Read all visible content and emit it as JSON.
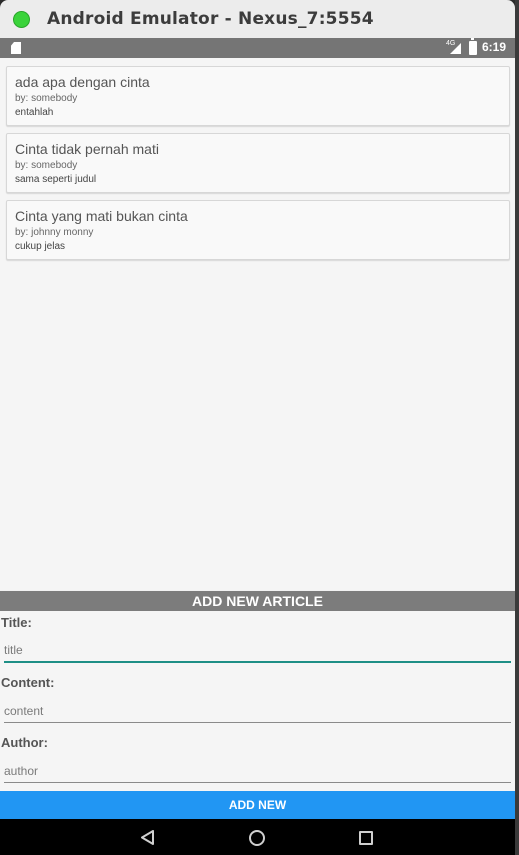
{
  "window": {
    "title": "Android Emulator - Nexus_7:5554"
  },
  "statusbar": {
    "network": "4G",
    "time": "6:19"
  },
  "articles": [
    {
      "title": "ada apa dengan cinta",
      "author": "by: somebody",
      "content": "entahlah"
    },
    {
      "title": "Cinta tidak pernah mati",
      "author": "by: somebody",
      "content": "sama seperti judul"
    },
    {
      "title": "Cinta yang mati bukan cinta",
      "author": "by: johnny monny",
      "content": "cukup jelas"
    }
  ],
  "form": {
    "header": "ADD NEW ARTICLE",
    "title_label": "Title:",
    "title_placeholder": "title",
    "content_label": "Content:",
    "content_placeholder": "content",
    "author_label": "Author:",
    "author_placeholder": "author",
    "submit_label": "ADD NEW"
  },
  "colors": {
    "accent": "#2196f3",
    "input_focus": "#1e8f86",
    "statusbar": "#757575"
  }
}
